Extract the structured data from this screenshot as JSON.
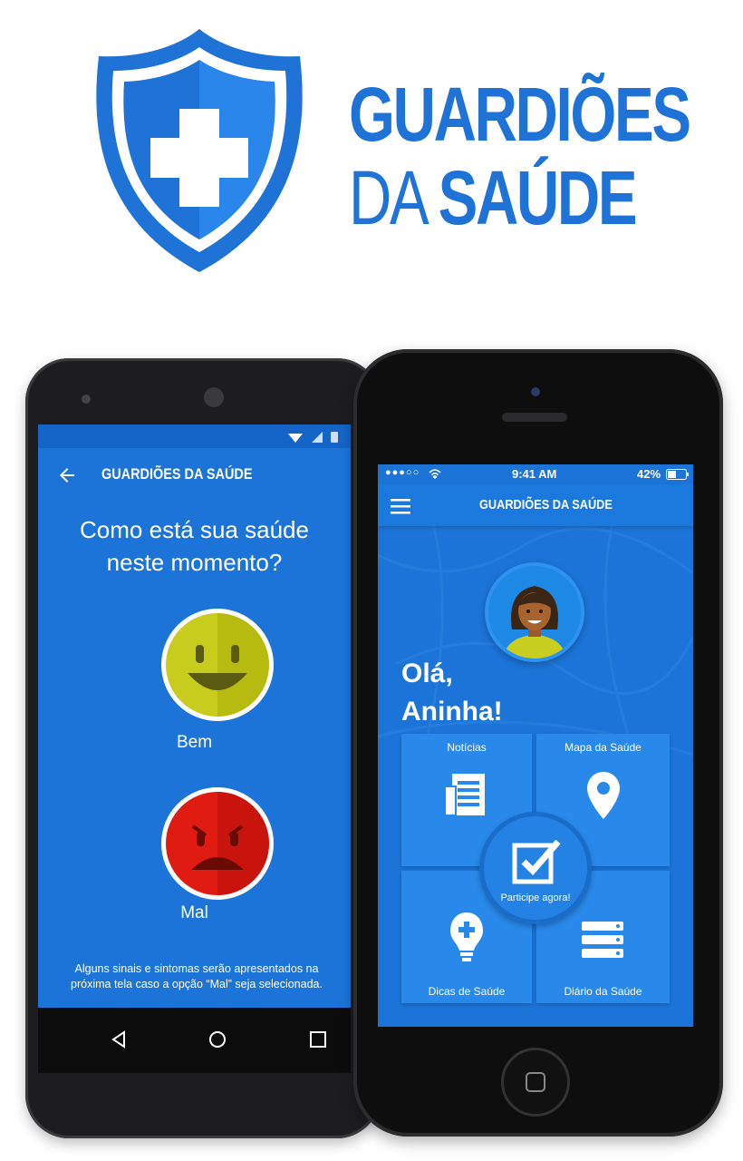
{
  "brand": {
    "line1": "GUARDIÕES",
    "line2_light": "DA ",
    "line2_bold": "SAÚDE"
  },
  "colors": {
    "brand_blue": "#1f73d6",
    "screen_blue": "#1c74d8",
    "good_face": "#c8cc1c",
    "bad_face": "#e01c12"
  },
  "android": {
    "appbar": {
      "title": "GUARDIÕES DA SAÚDE",
      "back_icon": "arrow-left-icon"
    },
    "question": [
      "Como está sua saúde",
      "neste momento?"
    ],
    "options": [
      {
        "label": "Bem",
        "icon": "smiley-happy-icon"
      },
      {
        "label": "Mal",
        "icon": "smiley-sad-icon"
      }
    ],
    "note": "Alguns sinais e sintomas serão apresentados na próxima tela caso a opção “Mal” seja selecionada.",
    "navbar": [
      "back-triangle-icon",
      "home-circle-icon",
      "recents-square-icon"
    ]
  },
  "iphone": {
    "status": {
      "time": "9:41 AM",
      "battery": "42%",
      "signal": "●●●○○"
    },
    "appbar": {
      "title": "GUARDIÕES DA SAÚDE",
      "menu_icon": "hamburger-icon"
    },
    "greeting_line1": "Olá,",
    "greeting_line2": "Aninha!",
    "tiles": [
      {
        "label": "Notícias",
        "icon": "newspaper-icon"
      },
      {
        "label": "Mapa da Saúde",
        "icon": "map-pin-icon"
      },
      {
        "label": "Dicas de Saúde",
        "icon": "lightbulb-plus-icon"
      },
      {
        "label": "Diário da Saúde",
        "icon": "database-icon"
      }
    ],
    "center": {
      "label": "Participe agora!",
      "icon": "checkbox-check-icon"
    }
  }
}
